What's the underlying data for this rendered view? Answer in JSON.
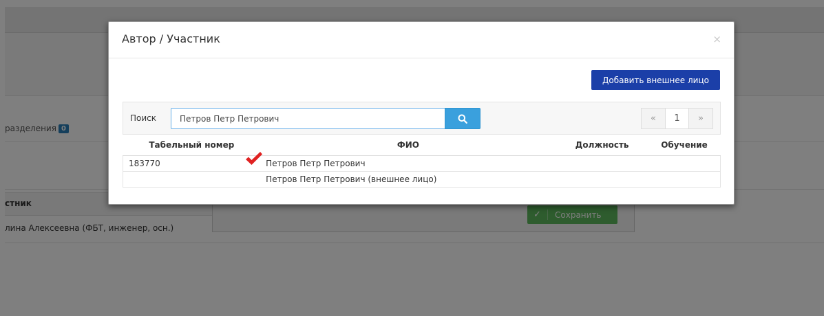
{
  "background": {
    "dept_label": "разделения",
    "dept_count": "0",
    "table_header": "стник",
    "table_row": "лина Алексеевна (ФБТ, инженер, осн.)",
    "save_button": "Сохранить"
  },
  "modal": {
    "title": "Автор / Участник",
    "close": "×",
    "add_external_button": "Добавить внешнее лицо",
    "search": {
      "label": "Поиск",
      "value": "Петров Петр Петрович"
    },
    "pager": {
      "prev": "«",
      "page": "1",
      "next": "»"
    },
    "table": {
      "columns": [
        "Табельный номер",
        "ФИО",
        "Должность",
        "Обучение"
      ],
      "rows": [
        {
          "tab_number": "183770",
          "fio": "Петров Петр Петрович",
          "position": "",
          "education": ""
        },
        {
          "tab_number": "",
          "fio": "Петров Петр Петрович (внешнее лицо)",
          "position": "",
          "education": ""
        }
      ]
    }
  },
  "colors": {
    "primary_button": "#1b3fa8",
    "search_button": "#3aa0dd",
    "badge": "#2a7fb8",
    "save_button": "#5cb85c",
    "checkmark": "#e02222"
  }
}
